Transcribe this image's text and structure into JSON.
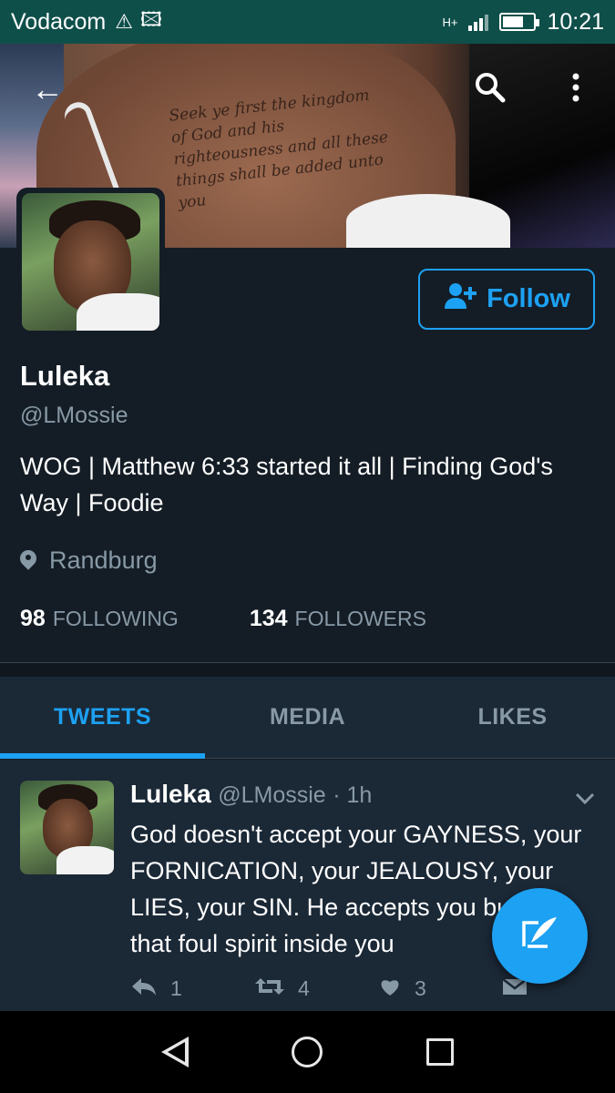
{
  "status_bar": {
    "carrier": "Vodacom",
    "network": "H+",
    "time": "10:21",
    "battery_level": 0.7
  },
  "header": {
    "back_icon": "arrow-left-icon",
    "search_icon": "search-icon",
    "menu_icon": "more-vertical-icon",
    "banner_tattoo_text": "Seek ye first the kingdom of God and his righteousness and all these things shall be added unto you"
  },
  "profile": {
    "name": "Luleka",
    "handle": "@LMossie",
    "bio": "WOG | Matthew 6:33 started it all | Finding God's Way | Foodie",
    "location": "Randburg",
    "following_count": "98",
    "following_label": "FOLLOWING",
    "followers_count": "134",
    "followers_label": "FOLLOWERS",
    "follow_button": "Follow"
  },
  "tabs": [
    {
      "label": "TWEETS",
      "active": true
    },
    {
      "label": "MEDIA",
      "active": false
    },
    {
      "label": "LIKES",
      "active": false
    }
  ],
  "tweet": {
    "name": "Luleka",
    "handle": "@LMossie",
    "time": "· 1h",
    "text": "God doesn't accept your GAYNESS, your FORNICATION, your JEALOUSY, your LIES, your SIN. He accepts you but not that foul spirit inside you",
    "replies": "1",
    "retweets": "4",
    "likes": "3"
  },
  "colors": {
    "accent": "#1da1f2",
    "background": "#141d26",
    "card": "#1b2836",
    "status_bar": "#0f4f4a",
    "muted": "#8899a6"
  }
}
